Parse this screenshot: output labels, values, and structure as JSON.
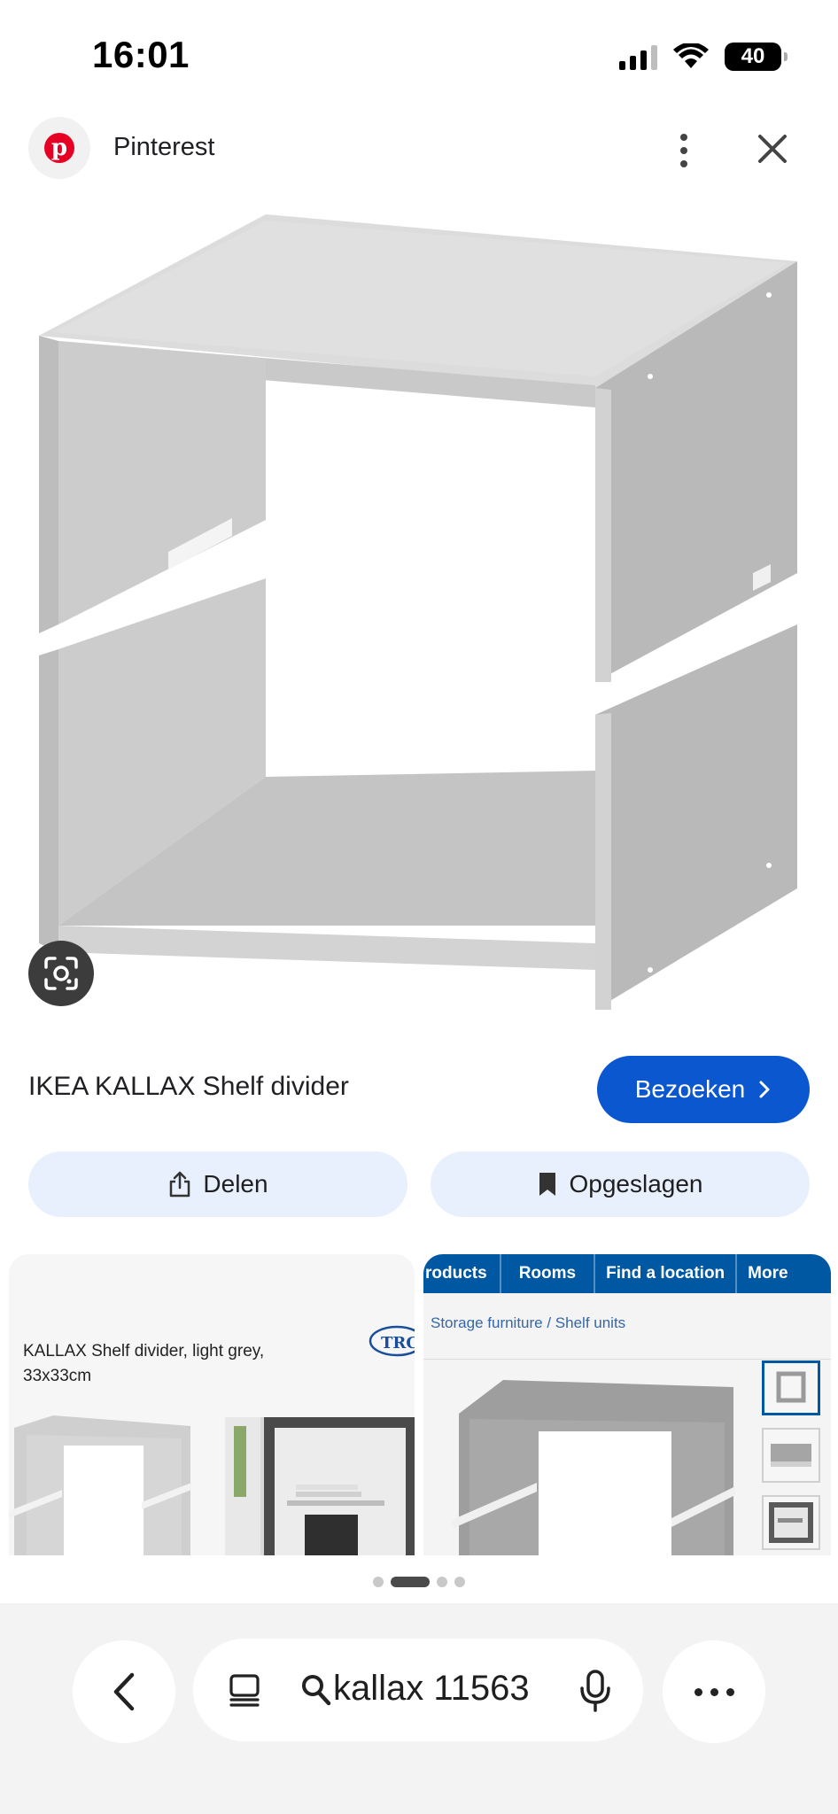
{
  "status_bar": {
    "time": "16:01",
    "battery": "40"
  },
  "source": {
    "name": "Pinterest",
    "logo_icon": "pinterest-icon",
    "logo_color": "#e60023"
  },
  "result": {
    "title": "IKEA KALLAX Shelf divider",
    "visit_label": "Bezoeken",
    "visit_color": "#0b57d0"
  },
  "actions": {
    "share_label": "Delen",
    "saved_label": "Opgeslagen"
  },
  "thumbnails": {
    "first": {
      "title_line1": "KALLAX Shelf divider, light grey,",
      "title_line2": "33x33cm",
      "logo_text": "TRC"
    },
    "second": {
      "nav": [
        "roducts",
        "Rooms",
        "Find a location",
        "More"
      ],
      "breadcrumb": "Storage furniture / Shelf units",
      "nav_color": "#0058a3"
    }
  },
  "pager": {
    "total": 4,
    "active": 2
  },
  "bottom_bar": {
    "query": "kallax 11563"
  }
}
